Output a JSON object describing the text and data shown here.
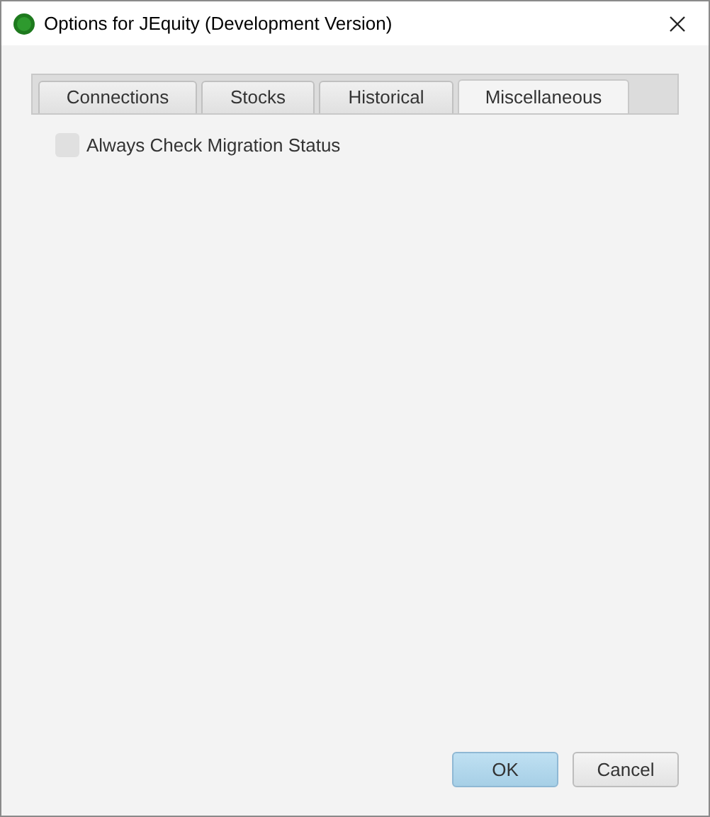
{
  "window": {
    "title": "Options for JEquity (Development Version)"
  },
  "tabs": [
    {
      "label": "Connections",
      "selected": false
    },
    {
      "label": "Stocks",
      "selected": false
    },
    {
      "label": "Historical",
      "selected": false
    },
    {
      "label": "Miscellaneous",
      "selected": true
    }
  ],
  "options": [
    {
      "label": "Always Check Migration Status",
      "checked": false
    }
  ],
  "buttons": [
    {
      "label": "OK",
      "default": true
    },
    {
      "label": "Cancel",
      "default": false
    }
  ]
}
